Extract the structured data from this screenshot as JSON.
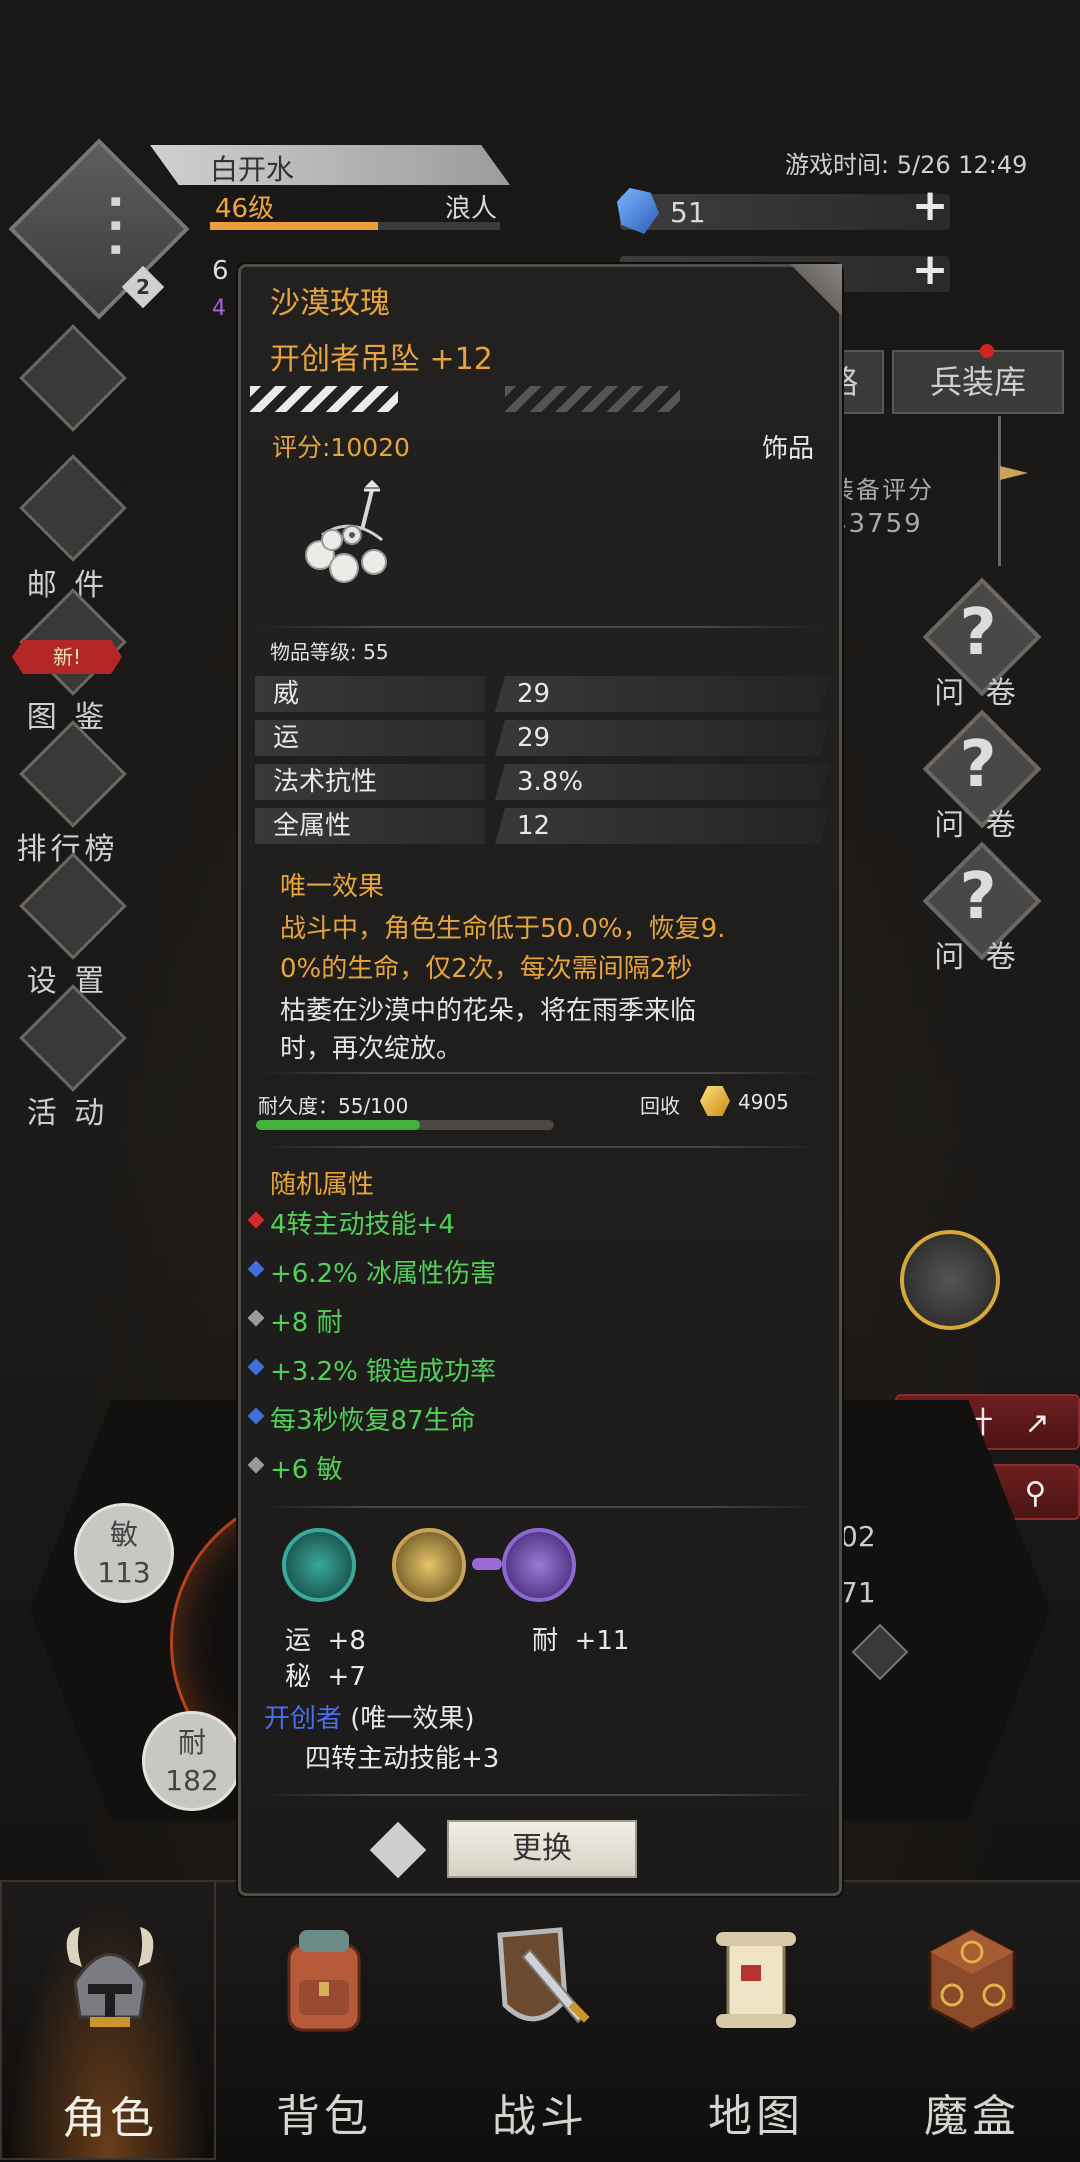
{
  "header": {
    "player_name": "白开水",
    "level": "46级",
    "class_name": "浪人",
    "xp_ratio": 0.58,
    "avatar_badge": "2",
    "game_time": "游戏时间: 5/26 12:49",
    "gems": "51",
    "second_row_left": "6",
    "second_row_sub": "4"
  },
  "tabs": {
    "left_partial": "略",
    "armory": "兵装库"
  },
  "score_panel": {
    "label": "装备评分",
    "value": "43759"
  },
  "side_menu": {
    "mail": "邮 件",
    "new_badge": "新!",
    "codex": "图 鉴",
    "ranking": "排行榜",
    "settings": "设 置",
    "events": "活 动"
  },
  "right_menu": {
    "survey1": "问 卷",
    "survey2": "问 卷",
    "survey3": "问 卷",
    "stats_button": "统计",
    "details_button": "详情"
  },
  "attributes": {
    "agi_label": "敏",
    "agi_value": "113",
    "con_label": "耐",
    "con_value": "182",
    "right_val_1": "02",
    "right_val_2": "71"
  },
  "item": {
    "set_name": "沙漠玫瑰",
    "name": "开创者吊坠 +12",
    "enhance_ratio": 0.55,
    "score": "评分:10020",
    "slot": "饰品",
    "item_level": "物品等级: 55",
    "stats": [
      {
        "name": "威",
        "value": "29"
      },
      {
        "name": "运",
        "value": "29"
      },
      {
        "name": "法术抗性",
        "value": "3.8%"
      },
      {
        "name": "全属性",
        "value": "12"
      }
    ],
    "unique_title": "唯一效果",
    "unique_effect_line1": "战斗中，角色生命低于50.0%，恢复9.",
    "unique_effect_line2": "0%的生命，仅2次，每次需间隔2秒",
    "flavor_line1": "枯萎在沙漠中的花朵，将在雨季来临",
    "flavor_line2": "时，再次绽放。",
    "durability": "耐久度：55/100",
    "durability_ratio": 0.55,
    "recycle_label": "回收",
    "recycle_value": "4905",
    "random_title": "随机属性",
    "random_attrs": [
      {
        "text": "4转主动技能+4",
        "gem": "#d42a2a"
      },
      {
        "text": "+6.2% 冰属性伤害",
        "gem": "#3f6fd8"
      },
      {
        "text": "+8 耐",
        "gem": "#9a9a9a"
      },
      {
        "text": "+3.2% 锻造成功率",
        "gem": "#3f6fd8"
      },
      {
        "text": "每3秒恢复87生命",
        "gem": "#3f6fd8"
      },
      {
        "text": "+6 敏",
        "gem": "#9a9a9a"
      }
    ],
    "socket_bonus_1a": "运  +8",
    "socket_bonus_1b": "秘  +7",
    "socket_bonus_2": "耐  +11",
    "set_title": "开创者",
    "set_title_suffix": "(唯一效果)",
    "set_effect": "四转主动技能+3",
    "swap_button": "更换"
  },
  "bottom_nav": {
    "character": "角色",
    "backpack": "背包",
    "battle": "战斗",
    "map": "地图",
    "magic_box": "魔盒"
  },
  "colors": {
    "gold": "#e6a43d",
    "green": "#52d05a",
    "set_blue": "#4a6df0"
  }
}
